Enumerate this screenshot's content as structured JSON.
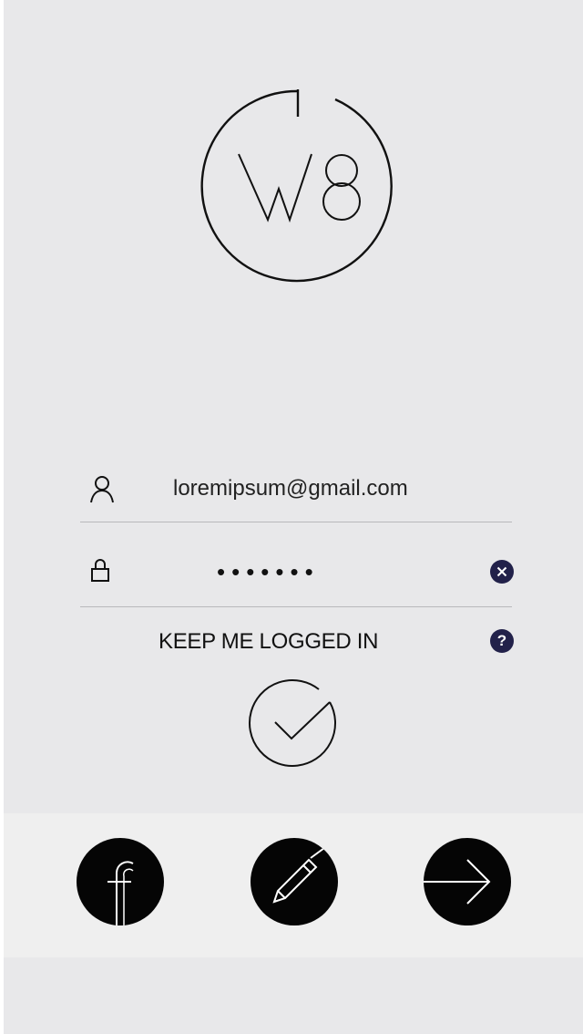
{
  "logo": {
    "text_left": "W",
    "text_right": "8"
  },
  "login": {
    "email_value": "loremipsum@gmail.com",
    "password_mask": "•••••••",
    "keep_logged_in_label": "KEEP ME LOGGED IN",
    "help_label": "?",
    "keep_logged_in_checked": true
  },
  "icons": {
    "user": "user-icon",
    "lock": "lock-icon",
    "clear": "close-circle-icon",
    "help": "question-circle-icon",
    "check": "check-circle-icon",
    "facebook": "facebook-icon",
    "pen": "pen-icon",
    "arrow": "arrow-right-icon"
  },
  "colors": {
    "background": "#e8e8ea",
    "accent": "#22214a",
    "button": "#050505",
    "action_bar": "#efefef"
  }
}
